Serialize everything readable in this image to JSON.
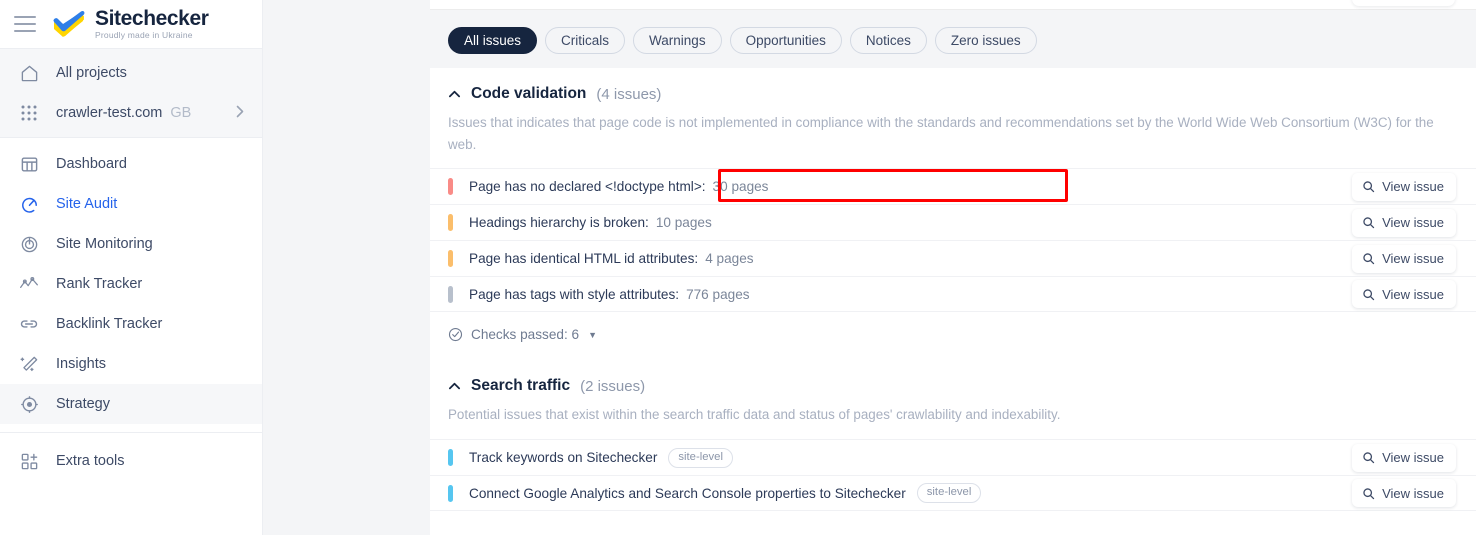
{
  "sidebar": {
    "menu_icon": "hamburger-menu-icon",
    "logo": {
      "name": "Sitechecker",
      "tagline": "Proudly made in Ukraine",
      "mark": "ukraine-check-icon",
      "colors": {
        "blue": "#2f7fe8",
        "yellow": "#ffd500"
      }
    },
    "group_items": [
      {
        "label": "All projects",
        "icon": "home-icon",
        "active": false
      },
      {
        "label": "crawler-test.com",
        "badge": "GB",
        "icon": "grid-dots-icon",
        "chevron": "chevron-right-icon",
        "active": false
      }
    ],
    "items": [
      {
        "label": "Dashboard",
        "icon": "dashboard-icon",
        "active": false
      },
      {
        "label": "Site Audit",
        "icon": "site-audit-icon",
        "active": true
      },
      {
        "label": "Site Monitoring",
        "icon": "site-monitoring-icon",
        "active": false
      },
      {
        "label": "Rank Tracker",
        "icon": "rank-tracker-icon",
        "active": false
      },
      {
        "label": "Backlink Tracker",
        "icon": "link-icon",
        "active": false
      },
      {
        "label": "Insights",
        "icon": "magic-wand-icon",
        "active": false
      },
      {
        "label": "Strategy",
        "icon": "target-icon",
        "active": false
      }
    ],
    "extra": {
      "label": "Extra tools",
      "icon": "extra-tools-icon"
    }
  },
  "filters": {
    "chips": [
      {
        "label": "All issues",
        "active": true
      },
      {
        "label": "Criticals",
        "active": false
      },
      {
        "label": "Warnings",
        "active": false
      },
      {
        "label": "Opportunities",
        "active": false
      },
      {
        "label": "Notices",
        "active": false
      },
      {
        "label": "Zero issues",
        "active": false
      }
    ]
  },
  "sections": [
    {
      "title": "Code validation",
      "count": "(4 issues)",
      "description": "Issues that indicates that page code is not implemented in compliance with the standards and recommendations set by the World Wide Web Consortium (W3C) for the web.",
      "issues": [
        {
          "label": "Page has no declared <!doctype html>:",
          "count": "30 pages",
          "severity": "#f98b87",
          "action": "View issue",
          "highlighted": true
        },
        {
          "label": "Headings hierarchy is broken:",
          "count": "10 pages",
          "severity": "#fbbe6b",
          "action": "View issue",
          "highlighted": false
        },
        {
          "label": "Page has identical HTML id attributes:",
          "count": "4 pages",
          "severity": "#fbbe6b",
          "action": "View issue",
          "highlighted": false
        },
        {
          "label": "Page has tags with style attributes:",
          "count": "776 pages",
          "severity": "#b8c0cc",
          "action": "View issue",
          "highlighted": false
        }
      ],
      "checks_passed": "Checks passed: 6"
    },
    {
      "title": "Search traffic",
      "count": "(2 issues)",
      "description": "Potential issues that exist within the search traffic data and status of pages' crawlability and indexability.",
      "issues": [
        {
          "label": "Track keywords on Sitechecker",
          "tag": "site-level",
          "severity": "#56c6f0",
          "action": "View issue",
          "highlighted": false
        },
        {
          "label": "Connect Google Analytics and Search Console properties to Sitechecker",
          "tag": "site-level",
          "severity": "#56c6f0",
          "action": "View issue",
          "highlighted": false
        }
      ]
    }
  ],
  "icons": {
    "search": "search-icon",
    "check_circle": "check-circle-icon",
    "caret_up": "caret-up-icon",
    "caret_down": "caret-down-icon"
  },
  "colors": {
    "accent": "#2563eb",
    "dark": "#16253f",
    "highlight_outline": "#ff0000"
  }
}
